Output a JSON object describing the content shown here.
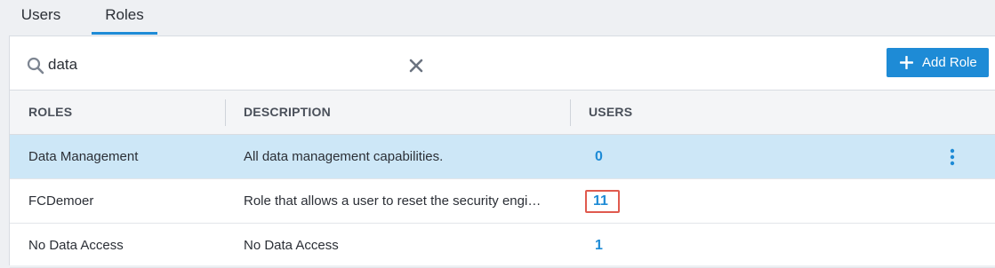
{
  "tabs": [
    {
      "label": "Users",
      "active": false
    },
    {
      "label": "Roles",
      "active": true
    }
  ],
  "search": {
    "value": "data",
    "icon": "search-icon",
    "clear_icon": "close-icon"
  },
  "toolbar": {
    "add_role_label": "Add Role",
    "add_icon": "plus-icon"
  },
  "table": {
    "columns": [
      "ROLES",
      "DESCRIPTION",
      "USERS"
    ],
    "rows": [
      {
        "role": "Data Management",
        "description": "All data management capabilities.",
        "users": "0",
        "selected": true
      },
      {
        "role": "FCDemoer",
        "description": "Role that allows a user to reset the security engi…",
        "users": "11",
        "highlighted": true
      },
      {
        "role": "No Data Access",
        "description": "No Data Access",
        "users": "1"
      }
    ]
  },
  "colors": {
    "accent": "#1e8bd6",
    "selected_row": "#cde7f7",
    "highlight_border": "#e05a4e"
  }
}
